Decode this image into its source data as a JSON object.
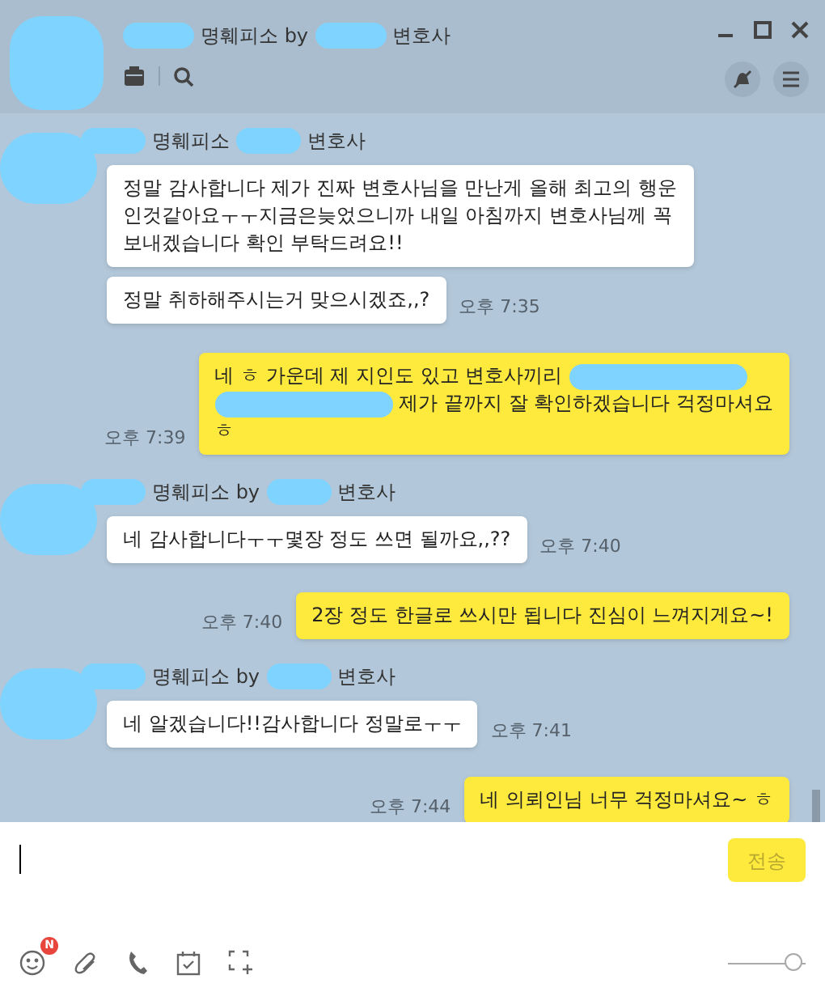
{
  "window": {
    "title": [
      {
        "kind": "redacted"
      },
      {
        "kind": "text",
        "text": "명훼피소 by"
      },
      {
        "kind": "redacted"
      },
      {
        "kind": "text",
        "text": "변호사"
      }
    ]
  },
  "messages": [
    {
      "kind": "received",
      "sender": [
        {
          "kind": "redacted"
        },
        {
          "kind": "text",
          "text": "명훼피소"
        },
        {
          "kind": "redacted"
        },
        {
          "kind": "text",
          "text": "변호사"
        }
      ],
      "bubbles": [
        {
          "lines": [
            [
              {
                "kind": "text",
                "text": "정말 감사합니다 제가 진짜 변호사님을 만난게 올해 최고의 행운"
              }
            ],
            [
              {
                "kind": "text",
                "text": "인것같아요ㅜㅜ지금은늦었으니까 내일 아침까지 변호사님께 꼭"
              }
            ],
            [
              {
                "kind": "text",
                "text": "보내겠습니다 확인 부탁드려요!!"
              }
            ]
          ]
        },
        {
          "lines": [
            [
              {
                "kind": "text",
                "text": "정말 취하해주시는거 맞으시겠죠,,?"
              }
            ]
          ],
          "time": "오후 7:35"
        }
      ]
    },
    {
      "kind": "sent",
      "lines": [
        [
          {
            "kind": "text",
            "text": "네 ㅎ 가운데 제 지인도 있고 변호사끼리"
          },
          {
            "kind": "redacted"
          }
        ],
        [
          {
            "kind": "redacted"
          },
          {
            "kind": "text",
            "text": "제가 끝까지 잘 확인하겠습니다 걱정마셔요"
          }
        ],
        [
          {
            "kind": "text",
            "text": "ㅎ"
          }
        ]
      ],
      "time": "오후 7:39"
    },
    {
      "kind": "received",
      "sender": [
        {
          "kind": "redacted"
        },
        {
          "kind": "text",
          "text": "명훼피소 by"
        },
        {
          "kind": "redacted"
        },
        {
          "kind": "text",
          "text": "변호사"
        }
      ],
      "bubbles": [
        {
          "lines": [
            [
              {
                "kind": "text",
                "text": "네 감사합니다ㅜㅜ몇장 정도 쓰면 될까요,,??"
              }
            ]
          ],
          "time": "오후 7:40"
        }
      ]
    },
    {
      "kind": "sent",
      "lines": [
        [
          {
            "kind": "text",
            "text": "2장 정도 한글로 쓰시만 됩니다 진심이 느껴지게요~!"
          }
        ]
      ],
      "time": "오후 7:40"
    },
    {
      "kind": "received",
      "sender": [
        {
          "kind": "redacted"
        },
        {
          "kind": "text",
          "text": "명훼피소 by"
        },
        {
          "kind": "redacted"
        },
        {
          "kind": "text",
          "text": "변호사"
        }
      ],
      "bubbles": [
        {
          "lines": [
            [
              {
                "kind": "text",
                "text": "네 알겠습니다!!감사합니다 정말로ㅜㅜ"
              }
            ]
          ],
          "time": "오후 7:41"
        }
      ]
    },
    {
      "kind": "sent",
      "lines": [
        [
          {
            "kind": "text",
            "text": "네 의뢰인님 너무 걱정마셔요~ ㅎ"
          }
        ]
      ],
      "time": "오후 7:44"
    }
  ],
  "composer": {
    "send_button": "전송",
    "emoji_badge": "N",
    "font_size": {
      "level": 0.95
    }
  }
}
